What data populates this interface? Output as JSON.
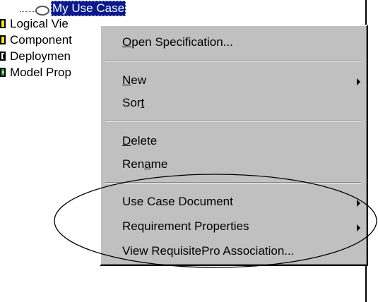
{
  "tree": {
    "selected_item": "My Use Case",
    "items": [
      {
        "label": "Logical Vie",
        "icon": "package-icon"
      },
      {
        "label": "Component",
        "icon": "package-icon"
      },
      {
        "label": "Deploymen",
        "icon": "deployment-icon"
      },
      {
        "label": "Model Prop",
        "icon": "model-properties-icon"
      }
    ]
  },
  "context_menu": {
    "open_specification": {
      "pre": "",
      "u": "O",
      "post": "pen Specification..."
    },
    "new": {
      "pre": "",
      "u": "N",
      "post": "ew"
    },
    "sort": {
      "pre": "Sor",
      "u": "t",
      "post": ""
    },
    "delete": {
      "pre": "",
      "u": "D",
      "post": "elete"
    },
    "rename": {
      "pre": "Ren",
      "u": "a",
      "post": "me"
    },
    "use_case_document": "Use Case Document",
    "requirement_properties": "Requirement Properties",
    "view_requisitepro_association": "View RequisitePro Association..."
  },
  "colors": {
    "selection_bg": "#0a1a8c",
    "menu_bg": "#c0c0c0",
    "package_icon": "#ffea00"
  }
}
